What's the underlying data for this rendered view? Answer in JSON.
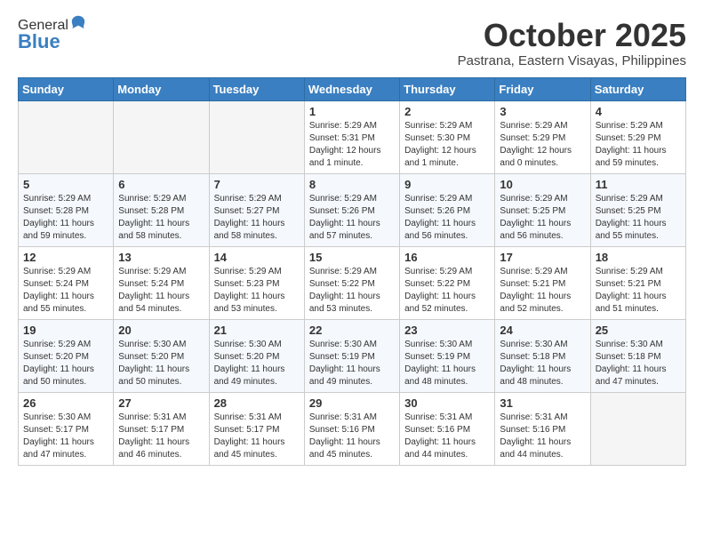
{
  "header": {
    "logo_general": "General",
    "logo_blue": "Blue",
    "month": "October 2025",
    "location": "Pastrana, Eastern Visayas, Philippines"
  },
  "weekdays": [
    "Sunday",
    "Monday",
    "Tuesday",
    "Wednesday",
    "Thursday",
    "Friday",
    "Saturday"
  ],
  "weeks": [
    [
      {
        "day": "",
        "info": ""
      },
      {
        "day": "",
        "info": ""
      },
      {
        "day": "",
        "info": ""
      },
      {
        "day": "1",
        "info": "Sunrise: 5:29 AM\nSunset: 5:31 PM\nDaylight: 12 hours\nand 1 minute."
      },
      {
        "day": "2",
        "info": "Sunrise: 5:29 AM\nSunset: 5:30 PM\nDaylight: 12 hours\nand 1 minute."
      },
      {
        "day": "3",
        "info": "Sunrise: 5:29 AM\nSunset: 5:29 PM\nDaylight: 12 hours\nand 0 minutes."
      },
      {
        "day": "4",
        "info": "Sunrise: 5:29 AM\nSunset: 5:29 PM\nDaylight: 11 hours\nand 59 minutes."
      }
    ],
    [
      {
        "day": "5",
        "info": "Sunrise: 5:29 AM\nSunset: 5:28 PM\nDaylight: 11 hours\nand 59 minutes."
      },
      {
        "day": "6",
        "info": "Sunrise: 5:29 AM\nSunset: 5:28 PM\nDaylight: 11 hours\nand 58 minutes."
      },
      {
        "day": "7",
        "info": "Sunrise: 5:29 AM\nSunset: 5:27 PM\nDaylight: 11 hours\nand 58 minutes."
      },
      {
        "day": "8",
        "info": "Sunrise: 5:29 AM\nSunset: 5:26 PM\nDaylight: 11 hours\nand 57 minutes."
      },
      {
        "day": "9",
        "info": "Sunrise: 5:29 AM\nSunset: 5:26 PM\nDaylight: 11 hours\nand 56 minutes."
      },
      {
        "day": "10",
        "info": "Sunrise: 5:29 AM\nSunset: 5:25 PM\nDaylight: 11 hours\nand 56 minutes."
      },
      {
        "day": "11",
        "info": "Sunrise: 5:29 AM\nSunset: 5:25 PM\nDaylight: 11 hours\nand 55 minutes."
      }
    ],
    [
      {
        "day": "12",
        "info": "Sunrise: 5:29 AM\nSunset: 5:24 PM\nDaylight: 11 hours\nand 55 minutes."
      },
      {
        "day": "13",
        "info": "Sunrise: 5:29 AM\nSunset: 5:24 PM\nDaylight: 11 hours\nand 54 minutes."
      },
      {
        "day": "14",
        "info": "Sunrise: 5:29 AM\nSunset: 5:23 PM\nDaylight: 11 hours\nand 53 minutes."
      },
      {
        "day": "15",
        "info": "Sunrise: 5:29 AM\nSunset: 5:22 PM\nDaylight: 11 hours\nand 53 minutes."
      },
      {
        "day": "16",
        "info": "Sunrise: 5:29 AM\nSunset: 5:22 PM\nDaylight: 11 hours\nand 52 minutes."
      },
      {
        "day": "17",
        "info": "Sunrise: 5:29 AM\nSunset: 5:21 PM\nDaylight: 11 hours\nand 52 minutes."
      },
      {
        "day": "18",
        "info": "Sunrise: 5:29 AM\nSunset: 5:21 PM\nDaylight: 11 hours\nand 51 minutes."
      }
    ],
    [
      {
        "day": "19",
        "info": "Sunrise: 5:29 AM\nSunset: 5:20 PM\nDaylight: 11 hours\nand 50 minutes."
      },
      {
        "day": "20",
        "info": "Sunrise: 5:30 AM\nSunset: 5:20 PM\nDaylight: 11 hours\nand 50 minutes."
      },
      {
        "day": "21",
        "info": "Sunrise: 5:30 AM\nSunset: 5:20 PM\nDaylight: 11 hours\nand 49 minutes."
      },
      {
        "day": "22",
        "info": "Sunrise: 5:30 AM\nSunset: 5:19 PM\nDaylight: 11 hours\nand 49 minutes."
      },
      {
        "day": "23",
        "info": "Sunrise: 5:30 AM\nSunset: 5:19 PM\nDaylight: 11 hours\nand 48 minutes."
      },
      {
        "day": "24",
        "info": "Sunrise: 5:30 AM\nSunset: 5:18 PM\nDaylight: 11 hours\nand 48 minutes."
      },
      {
        "day": "25",
        "info": "Sunrise: 5:30 AM\nSunset: 5:18 PM\nDaylight: 11 hours\nand 47 minutes."
      }
    ],
    [
      {
        "day": "26",
        "info": "Sunrise: 5:30 AM\nSunset: 5:17 PM\nDaylight: 11 hours\nand 47 minutes."
      },
      {
        "day": "27",
        "info": "Sunrise: 5:31 AM\nSunset: 5:17 PM\nDaylight: 11 hours\nand 46 minutes."
      },
      {
        "day": "28",
        "info": "Sunrise: 5:31 AM\nSunset: 5:17 PM\nDaylight: 11 hours\nand 45 minutes."
      },
      {
        "day": "29",
        "info": "Sunrise: 5:31 AM\nSunset: 5:16 PM\nDaylight: 11 hours\nand 45 minutes."
      },
      {
        "day": "30",
        "info": "Sunrise: 5:31 AM\nSunset: 5:16 PM\nDaylight: 11 hours\nand 44 minutes."
      },
      {
        "day": "31",
        "info": "Sunrise: 5:31 AM\nSunset: 5:16 PM\nDaylight: 11 hours\nand 44 minutes."
      },
      {
        "day": "",
        "info": ""
      }
    ]
  ]
}
